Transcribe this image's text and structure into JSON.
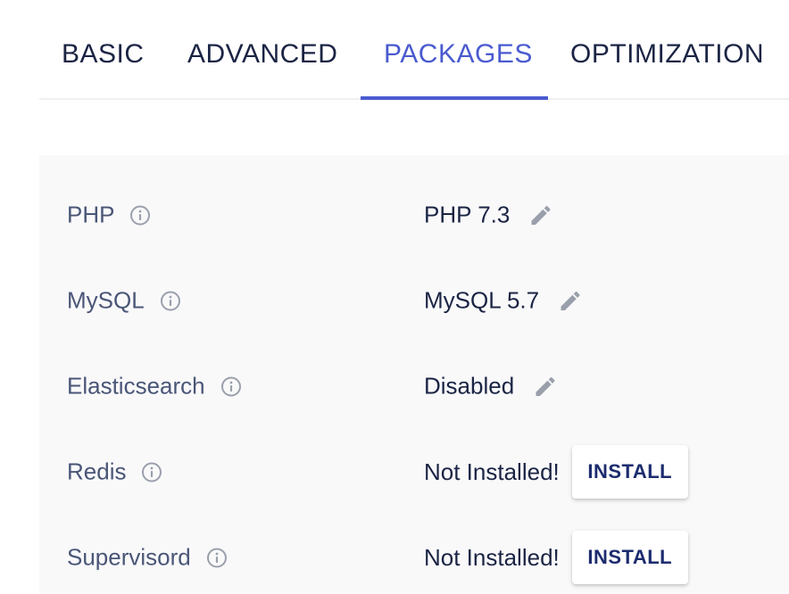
{
  "tabs": [
    {
      "label": "BASIC",
      "active": false
    },
    {
      "label": "ADVANCED",
      "active": false
    },
    {
      "label": "PACKAGES",
      "active": true
    },
    {
      "label": "OPTIMIZATION",
      "active": false
    }
  ],
  "packages": [
    {
      "label": "PHP",
      "value": "PHP 7.3",
      "action": "edit"
    },
    {
      "label": "MySQL",
      "value": "MySQL 5.7",
      "action": "edit"
    },
    {
      "label": "Elasticsearch",
      "value": "Disabled",
      "action": "edit"
    },
    {
      "label": "Redis",
      "value": "Not Installed!",
      "action": "install",
      "button_label": "INSTALL"
    },
    {
      "label": "Supervisord",
      "value": "Not Installed!",
      "action": "install",
      "button_label": "INSTALL"
    }
  ],
  "colors": {
    "accent": "#4a5bd0",
    "text_dark": "#1b2444",
    "text_muted": "#4a5677",
    "icon_gray": "#9aa0ab",
    "panel_bg": "#f9f9fa"
  },
  "icons": {
    "info": "info-circle-icon",
    "edit": "pencil-icon"
  }
}
